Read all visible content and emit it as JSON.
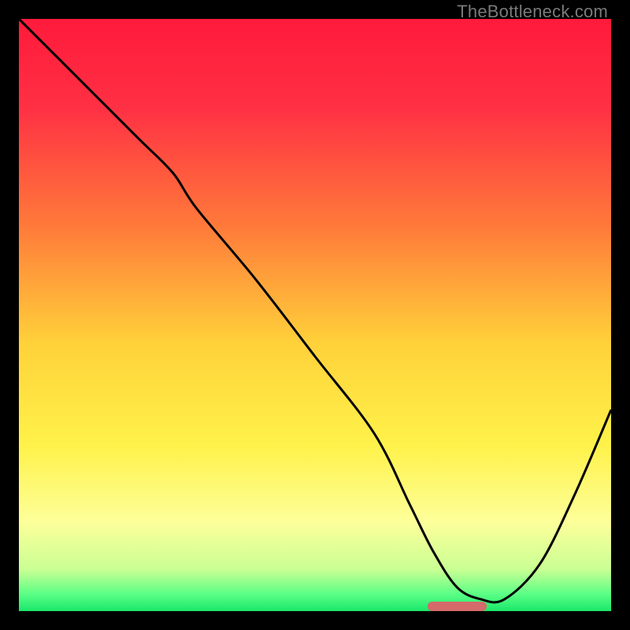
{
  "watermark": "TheBottleneck.com",
  "chart_data": {
    "type": "line",
    "title": "",
    "xlabel": "",
    "ylabel": "",
    "xlim": [
      0,
      100
    ],
    "ylim": [
      0,
      100
    ],
    "grid": false,
    "legend": false,
    "background_gradient_stops": [
      {
        "offset": 0.0,
        "color": "#ff1a3b"
      },
      {
        "offset": 0.15,
        "color": "#ff3044"
      },
      {
        "offset": 0.35,
        "color": "#ff7a3a"
      },
      {
        "offset": 0.55,
        "color": "#ffd23a"
      },
      {
        "offset": 0.72,
        "color": "#fff24a"
      },
      {
        "offset": 0.85,
        "color": "#fdff9a"
      },
      {
        "offset": 0.93,
        "color": "#c9ff94"
      },
      {
        "offset": 0.97,
        "color": "#5eff86"
      },
      {
        "offset": 1.0,
        "color": "#19e86b"
      }
    ],
    "series": [
      {
        "name": "bottleneck-curve",
        "x": [
          0,
          10,
          20,
          26,
          30,
          40,
          50,
          60,
          66,
          70,
          74,
          78,
          82,
          88,
          94,
          100
        ],
        "y": [
          100,
          90,
          80,
          74,
          68,
          56,
          43,
          30,
          18,
          10,
          4,
          2,
          2,
          8,
          20,
          34
        ]
      }
    ],
    "marker": {
      "name": "optimal-zone",
      "x_center": 74,
      "width": 10,
      "color": "#d46a6a"
    }
  }
}
